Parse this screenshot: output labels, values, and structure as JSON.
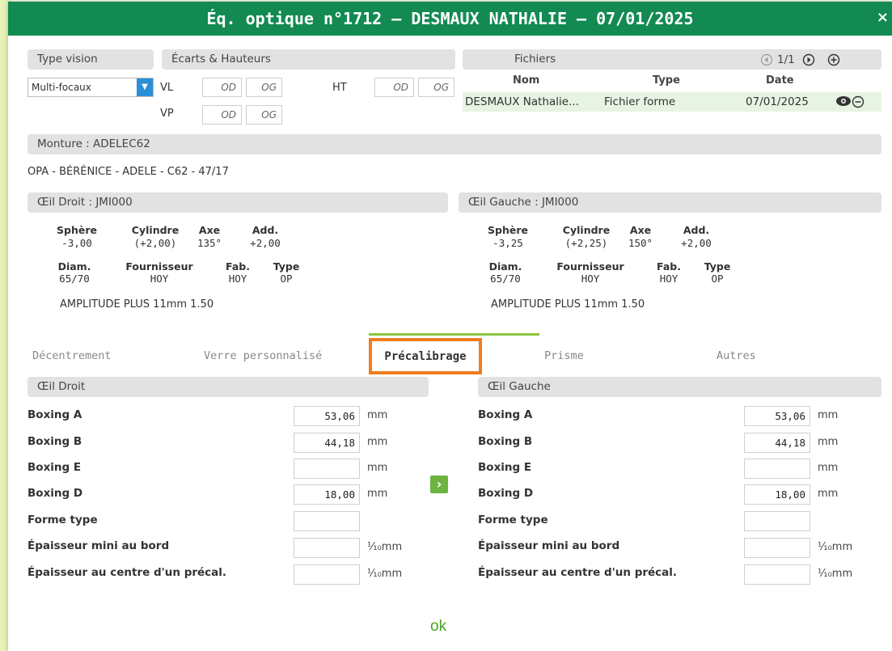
{
  "title": "Éq. optique n°1712 – DESMAUX NATHALIE – 07/01/2025",
  "close": "×",
  "type_vision": {
    "header": "Type vision",
    "value": "Multi-focaux"
  },
  "ecarts": {
    "header": "Écarts & Hauteurs",
    "vl": "VL",
    "vp": "VP",
    "ht": "HT",
    "od": "OD",
    "og": "OG"
  },
  "fichiers": {
    "header": "Fichiers",
    "page": "1/1",
    "columns": [
      "Nom",
      "Type",
      "Date"
    ],
    "rows": [
      {
        "nom": "DESMAUX Nathalie...",
        "type": "Fichier forme",
        "date": "07/01/2025"
      }
    ]
  },
  "monture": {
    "header": "Monture : ADELEC62",
    "desc": "OPA - BÉRÉNICE - ADELE - C62 - 47/17"
  },
  "oeil_droit": {
    "header": "Œil Droit : JMI000",
    "sphere": "-3,00",
    "cylindre": "(+2,00)",
    "axe": "135°",
    "add": "+2,00",
    "diam": "65/70",
    "fournisseur": "HOY",
    "fab": "HOY",
    "type": "OP",
    "verre": "AMPLITUDE PLUS 11mm 1.50"
  },
  "oeil_gauche": {
    "header": "Œil Gauche : JMI000",
    "sphere": "-3,25",
    "cylindre": "(+2,25)",
    "axe": "150°",
    "add": "+2,00",
    "diam": "65/70",
    "fournisseur": "HOY",
    "fab": "HOY",
    "type": "OP",
    "verre": "AMPLITUDE PLUS 11mm 1.50"
  },
  "labels": {
    "sphere": "Sphère",
    "cylindre": "Cylindre",
    "axe": "Axe",
    "add": "Add.",
    "diam": "Diam.",
    "fournisseur": "Fournisseur",
    "fab": "Fab.",
    "type": "Type"
  },
  "tabs": [
    "Décentrement",
    "Verre personnalisé",
    "Précalibrage",
    "Prisme",
    "Autres"
  ],
  "precal": {
    "droit_header": "Œil Droit",
    "gauche_header": "Œil Gauche",
    "fields": [
      {
        "label": "Boxing A",
        "droit": "53,06",
        "gauche": "53,06",
        "unit": "mm"
      },
      {
        "label": "Boxing B",
        "droit": "44,18",
        "gauche": "44,18",
        "unit": "mm"
      },
      {
        "label": "Boxing E",
        "droit": "",
        "gauche": "",
        "unit": "mm"
      },
      {
        "label": "Boxing D",
        "droit": "18,00",
        "gauche": "18,00",
        "unit": "mm"
      },
      {
        "label": "Forme type",
        "droit": "",
        "gauche": "",
        "unit": ""
      },
      {
        "label": "Épaisseur mini au bord",
        "droit": "",
        "gauche": "",
        "unit": "⅒mm"
      },
      {
        "label": "Épaisseur au centre d'un précal.",
        "droit": "",
        "gauche": "",
        "unit": "⅒mm"
      }
    ]
  },
  "copy_button": "›",
  "ok": "ok"
}
